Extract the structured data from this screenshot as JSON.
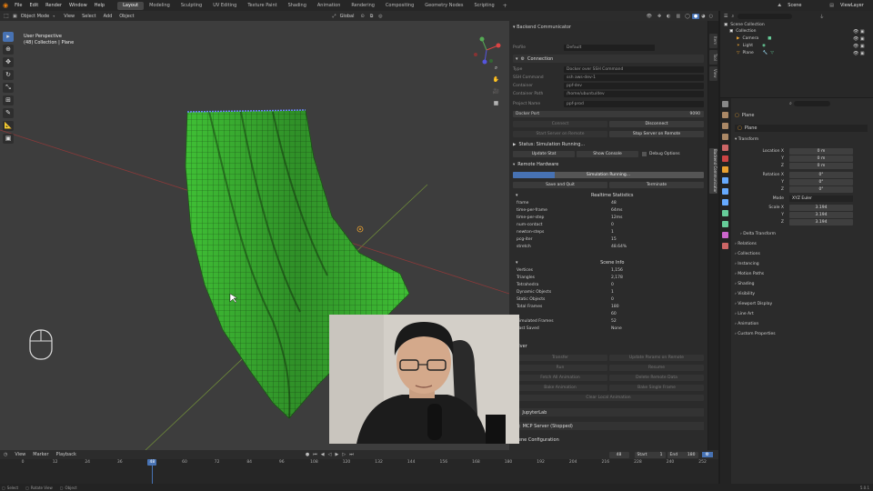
{
  "topbar": {
    "menus": [
      "File",
      "Edit",
      "Render",
      "Window",
      "Help"
    ],
    "workspaces": [
      "Layout",
      "Modeling",
      "Sculpting",
      "UV Editing",
      "Texture Paint",
      "Shading",
      "Animation",
      "Rendering",
      "Compositing",
      "Geometry Nodes",
      "Scripting"
    ],
    "active_workspace": "Layout",
    "scene": "Scene",
    "view_layer": "ViewLayer"
  },
  "viewport_header": {
    "mode": "Object Mode",
    "menus": [
      "View",
      "Select",
      "Add",
      "Object"
    ],
    "orientation": "Global",
    "options": "Options"
  },
  "viewport": {
    "perspective": "User Perspective",
    "context": "(48) Collection | Plane"
  },
  "backend": {
    "title": "Backend Communicator",
    "profile_label": "Profile",
    "profile_value": "Default",
    "connection_title": "Connection",
    "fields": [
      {
        "label": "Type",
        "value": "Docker over SSH Command"
      },
      {
        "label": "SSH Command",
        "value": "ssh aws-dev-1"
      },
      {
        "label": "Container",
        "value": "ppf-dev"
      },
      {
        "label": "Container Path",
        "value": "/home/ubuntu/dev"
      },
      {
        "label": "Project Name",
        "value": "ppf-prod"
      }
    ],
    "docker_port_label": "Docker Port",
    "docker_port_value": "9090",
    "connect": "Connect",
    "disconnect": "Disconnect",
    "start_server": "Start Server on Remote",
    "stop_server": "Stop Server on Remote",
    "status": "Status: Simulation Running...",
    "update_stat": "Update Stat",
    "show_console": "Show Console",
    "debug_options": "Debug Options",
    "remote_hardware": "Remote Hardware",
    "progress_text": "Simulation Running...",
    "progress": 0.22,
    "save_and_quit": "Save and Quit",
    "terminate": "Terminate",
    "realtime_title": "Realtime Statistics",
    "realtime": [
      {
        "k": "frame",
        "v": "48"
      },
      {
        "k": "time-per-frame",
        "v": "64ms"
      },
      {
        "k": "time-per-step",
        "v": "12ms"
      },
      {
        "k": "num-contact",
        "v": "0"
      },
      {
        "k": "newton-steps",
        "v": "1"
      },
      {
        "k": "pcg-iter",
        "v": "15"
      },
      {
        "k": "stretch",
        "v": "48.64%"
      }
    ],
    "scene_info_title": "Scene Info",
    "scene_info": [
      {
        "k": "Vertices",
        "v": "1,156"
      },
      {
        "k": "Triangles",
        "v": "2,178"
      },
      {
        "k": "Tetrahedra",
        "v": "0"
      },
      {
        "k": "Dynamic Objects",
        "v": "1"
      },
      {
        "k": "Static Objects",
        "v": "0"
      },
      {
        "k": "Total Frames",
        "v": "180"
      },
      {
        "k": "",
        "v": "60"
      },
      {
        "k": "Simulated Frames",
        "v": "52"
      },
      {
        "k": "Last Saved",
        "v": "None"
      }
    ],
    "solver_title": "Solver",
    "solver_buttons": [
      "Transfer",
      "Update Params on Remote",
      "Run",
      "Resume",
      "Fetch All Animation",
      "Delete Remote Data",
      "Bake Animation",
      "Bake Single Frame",
      "Clear Local Animation"
    ],
    "jupyter": "JupyterLab",
    "mcp": "MCP Server (Stopped)",
    "scene_config": "Scene Configuration"
  },
  "vtabs": [
    "Item",
    "Tool",
    "View",
    "Backend Communicator"
  ],
  "outliner": {
    "title": "Scene Collection",
    "search_placeholder": "",
    "items": [
      "Collection",
      "Camera",
      "Light",
      "Plane"
    ]
  },
  "properties": {
    "object_name": "Plane",
    "data_name": "Plane",
    "transform_title": "Transform",
    "location_label": [
      "Location X",
      "Y",
      "Z"
    ],
    "location": [
      "0 m",
      "0 m",
      "0 m"
    ],
    "rotation_label": [
      "Rotation X",
      "Y",
      "Z"
    ],
    "rotation": [
      "0°",
      "0°",
      "0°"
    ],
    "mode_label": "Mode",
    "mode_value": "XYZ Euler",
    "scale_label": [
      "Scale X",
      "Y",
      "Z"
    ],
    "scale": [
      "3.194",
      "3.194",
      "3.194"
    ],
    "delta": "Delta Transform",
    "sections": [
      "Relations",
      "Collections",
      "Instancing",
      "Motion Paths",
      "Shading",
      "Visibility",
      "Viewport Display",
      "Line Art",
      "Animation",
      "Custom Properties"
    ]
  },
  "timeline": {
    "menus": [
      "View",
      "Marker",
      "Playback"
    ],
    "current_frame": "48",
    "start_label": "Start",
    "start": "1",
    "end_label": "End",
    "end": "180",
    "ticks": [
      "0",
      "12",
      "24",
      "36",
      "48",
      "60",
      "72",
      "84",
      "96",
      "108",
      "120",
      "132",
      "144",
      "156",
      "168",
      "180",
      "192",
      "204",
      "216",
      "228",
      "240",
      "252"
    ]
  },
  "statusbar": {
    "left": [
      "Select",
      "Rotate View",
      "Object"
    ],
    "version": "5.0.1"
  },
  "colors": {
    "accent": "#4772b3",
    "mesh_green": "#3fbf35",
    "panel_bg": "#2b2b2b"
  }
}
